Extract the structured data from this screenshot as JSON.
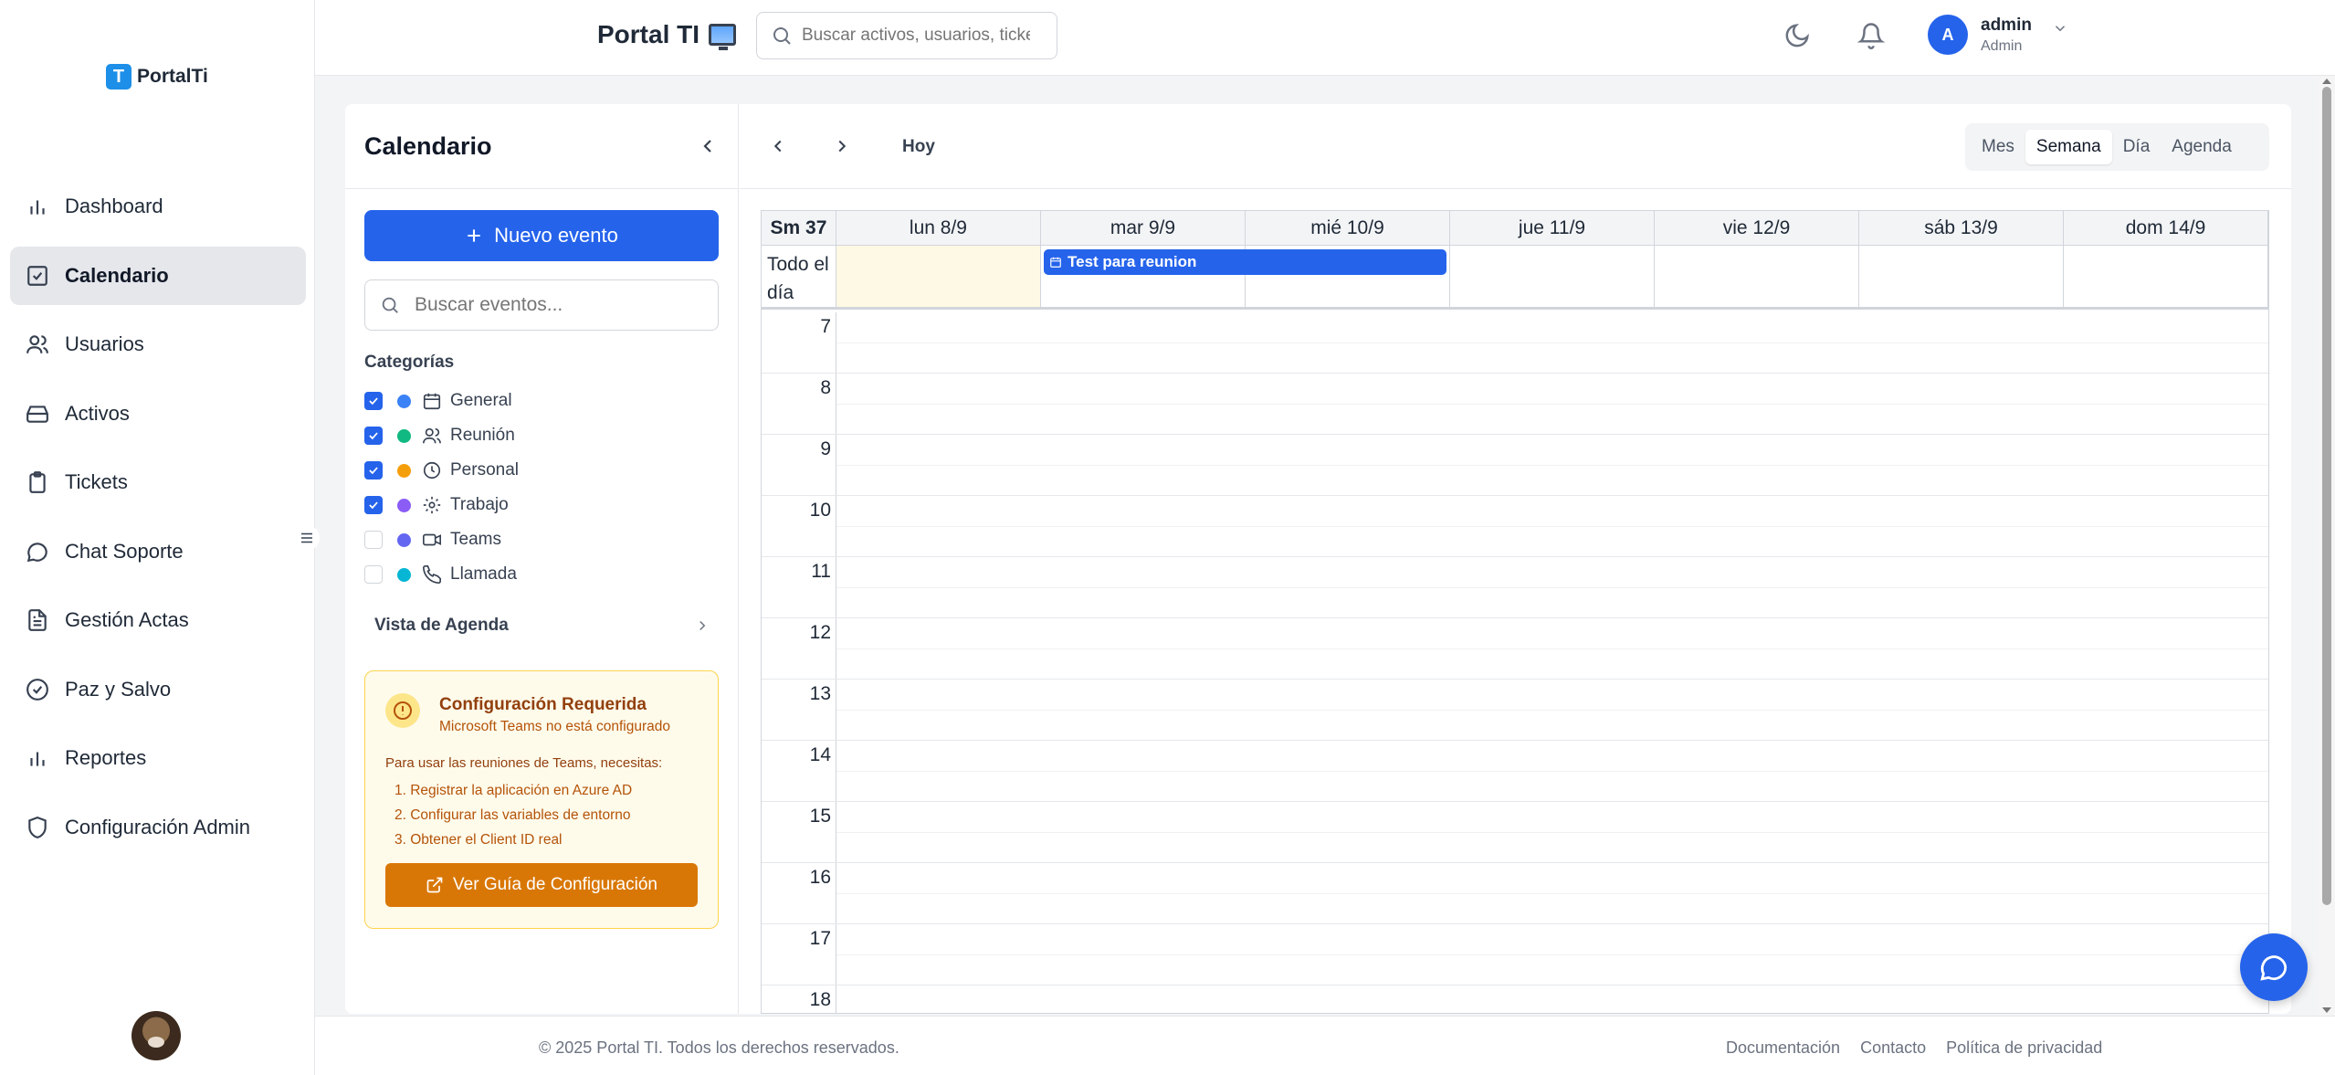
{
  "app": {
    "logo_letter": "T",
    "logo_text": "PortalTi",
    "portal_title": "Portal TI"
  },
  "search": {
    "placeholder": "Buscar activos, usuarios, tickets..."
  },
  "user": {
    "initial": "A",
    "name": "admin",
    "role": "Admin"
  },
  "sidebar": {
    "items": [
      {
        "label": "Dashboard",
        "icon": "bar-chart-icon"
      },
      {
        "label": "Calendario",
        "icon": "calendar-check-icon",
        "active": true
      },
      {
        "label": "Usuarios",
        "icon": "users-icon"
      },
      {
        "label": "Activos",
        "icon": "hard-drive-icon"
      },
      {
        "label": "Tickets",
        "icon": "clipboard-icon"
      },
      {
        "label": "Chat Soporte",
        "icon": "chat-bubble-icon"
      },
      {
        "label": "Gestión Actas",
        "icon": "document-icon"
      },
      {
        "label": "Paz y Salvo",
        "icon": "check-circle-icon"
      },
      {
        "label": "Reportes",
        "icon": "bar-chart-icon"
      },
      {
        "label": "Configuración Admin",
        "icon": "shield-icon"
      }
    ]
  },
  "calendar_panel": {
    "title": "Calendario",
    "new_event": "Nuevo evento",
    "search_placeholder": "Buscar eventos...",
    "categories_title": "Categorías",
    "categories": [
      {
        "label": "General",
        "color": "#3b82f6",
        "checked": true,
        "icon": "calendar-icon"
      },
      {
        "label": "Reunión",
        "color": "#10b981",
        "checked": true,
        "icon": "users-icon"
      },
      {
        "label": "Personal",
        "color": "#f59e0b",
        "checked": true,
        "icon": "clock-icon"
      },
      {
        "label": "Trabajo",
        "color": "#8b5cf6",
        "checked": true,
        "icon": "gear-icon"
      },
      {
        "label": "Teams",
        "color": "#6366f1",
        "checked": false,
        "icon": "video-icon"
      },
      {
        "label": "Llamada",
        "color": "#06b6d4",
        "checked": false,
        "icon": "phone-icon"
      }
    ],
    "agenda_link": "Vista de Agenda",
    "config": {
      "title": "Configuración Requerida",
      "subtitle": "Microsoft Teams no está configurado",
      "text": "Para usar las reuniones de Teams, necesitas:",
      "steps": [
        "1. Registrar la aplicación en Azure AD",
        "2. Configurar las variables de entorno",
        "3. Obtener el Client ID real"
      ],
      "button": "Ver Guía de Configuración"
    }
  },
  "toolbar": {
    "today": "Hoy",
    "views": [
      "Mes",
      "Semana",
      "Día",
      "Agenda"
    ],
    "active_view": "Semana"
  },
  "week": {
    "label": "Sm 37",
    "days": [
      "lun 8/9",
      "mar 9/9",
      "mié 10/9",
      "jue 11/9",
      "vie 12/9",
      "sáb 13/9",
      "dom 14/9"
    ],
    "all_day_label": "Todo el día",
    "all_day_events": [
      {
        "title": "Test para reunion",
        "color": "#2563eb"
      }
    ],
    "hours": [
      "7",
      "8",
      "9",
      "10",
      "11",
      "12",
      "13",
      "14",
      "15",
      "16",
      "17",
      "18"
    ]
  },
  "footer": {
    "copyright": "© 2025 Portal TI. Todos los derechos reservados.",
    "links": [
      "Documentación",
      "Contacto",
      "Política de privacidad"
    ]
  }
}
